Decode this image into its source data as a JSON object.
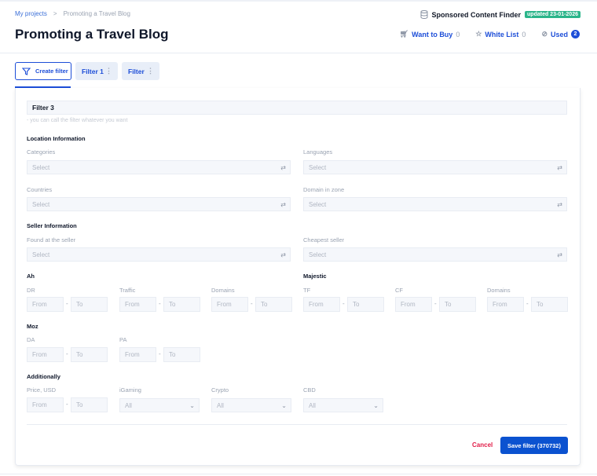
{
  "breadcrumb": {
    "root": "My projects",
    "separator": ">",
    "current": "Promoting a Travel Blog"
  },
  "header": {
    "title": "Promoting a Travel Blog",
    "finder": "Sponsored Content Finder",
    "updated": "updated 23-01-2026"
  },
  "lists": {
    "want_to_buy": {
      "label": "Want to Buy",
      "count": "0"
    },
    "white_list": {
      "label": "White List",
      "count": "0"
    },
    "used": {
      "label": "Used",
      "count": "2"
    }
  },
  "tabs": {
    "create": "Create filter",
    "items": [
      "Filter 1",
      "Filter"
    ]
  },
  "form": {
    "name_value": "Filter 3",
    "hint": "- you can call the filter whatever you want",
    "location": {
      "title": "Location Information",
      "categories": "Categories",
      "languages": "Languages",
      "countries": "Countries",
      "domain_zone": "Domain in zone"
    },
    "seller": {
      "title": "Seller Information",
      "found": "Found at the seller",
      "cheapest": "Cheapest seller"
    },
    "select_placeholder": "Select",
    "ah": {
      "title": "Ah",
      "fields": [
        "DR",
        "Traffic",
        "Domains"
      ]
    },
    "majestic": {
      "title": "Majestic",
      "fields": [
        "TF",
        "CF",
        "Domains"
      ]
    },
    "moz": {
      "title": "Moz",
      "fields": [
        "DA",
        "PA"
      ]
    },
    "additionally": {
      "title": "Additionally",
      "price": "Price, USD",
      "igaming": "iGaming",
      "crypto": "Crypto",
      "cbd": "CBD",
      "all": "All"
    },
    "from": "From",
    "to": "To",
    "dash": "-"
  },
  "actions": {
    "cancel": "Cancel",
    "save": "Save filter (370732)"
  }
}
